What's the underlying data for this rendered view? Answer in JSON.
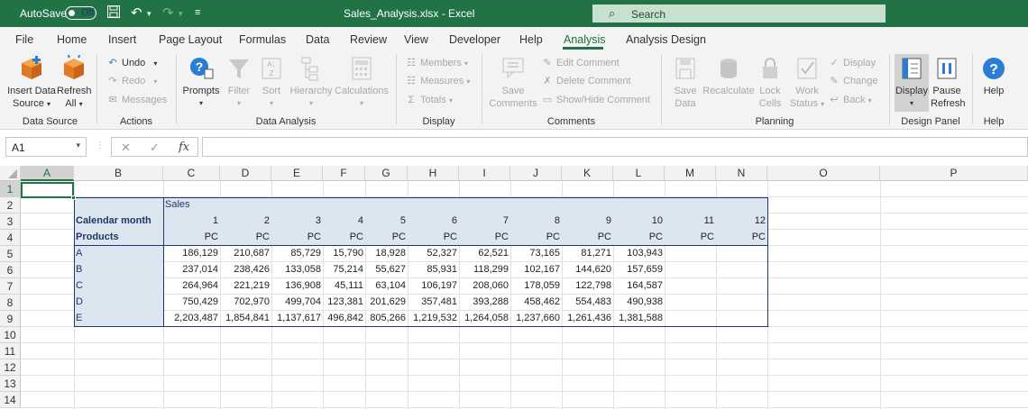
{
  "titlebar": {
    "autosave_label": "AutoSave",
    "autosave_state": "Off",
    "doc_title": "Sales_Analysis.xlsx  -  Excel",
    "search_placeholder": "Search",
    "save_icon": "save-icon",
    "undo_icon": "undo-icon",
    "redo_icon": "redo-icon",
    "customize_icon": "customize-qat-icon"
  },
  "menu": {
    "items": [
      "File",
      "Home",
      "Insert",
      "Page Layout",
      "Formulas",
      "Data",
      "Review",
      "View",
      "Developer",
      "Help",
      "Analysis",
      "Analysis Design"
    ],
    "active": "Analysis"
  },
  "ribbon": {
    "data_source": {
      "insert_line1": "Insert Data",
      "insert_line2": "Source",
      "refresh_line1": "Refresh",
      "refresh_line2": "All",
      "label": "Data Source"
    },
    "actions": {
      "undo": "Undo",
      "redo": "Redo",
      "messages": "Messages",
      "label": "Actions"
    },
    "data_analysis": {
      "prompts": "Prompts",
      "filter": "Filter",
      "sort": "Sort",
      "hierarchy": "Hierarchy",
      "calculations": "Calculations",
      "label": "Data Analysis"
    },
    "display": {
      "members": "Members",
      "measures": "Measures",
      "totals": "Totals",
      "label": "Display"
    },
    "comments": {
      "save_line1": "Save",
      "save_line2": "Comments",
      "edit": "Edit Comment",
      "delete": "Delete Comment",
      "showhide": "Show/Hide Comment",
      "label": "Comments"
    },
    "planning": {
      "save_line1": "Save",
      "save_line2": "Data",
      "recalculate": "Recalculate",
      "lock_line1": "Lock",
      "lock_line2": "Cells",
      "work_line1": "Work",
      "work_line2": "Status",
      "display": "Display",
      "change": "Change",
      "back": "Back",
      "label": "Planning"
    },
    "design_panel": {
      "display": "Display",
      "pause_line1": "Pause",
      "pause_line2": "Refresh",
      "label": "Design Panel"
    },
    "help": {
      "help": "Help",
      "label": "Help"
    }
  },
  "formula_bar": {
    "name_box": "A1",
    "cancel": "✕",
    "enter": "✓",
    "fx": "fx",
    "value": ""
  },
  "sheet": {
    "columns": [
      "A",
      "B",
      "C",
      "D",
      "E",
      "F",
      "G",
      "H",
      "I",
      "J",
      "K",
      "L",
      "M",
      "N",
      "O",
      "P"
    ],
    "rows": [
      "1",
      "2",
      "3",
      "4",
      "5",
      "6",
      "7",
      "8",
      "9",
      "10",
      "11",
      "12",
      "13",
      "14"
    ],
    "sales_label": "Sales",
    "calendar_label": "Calendar month",
    "products_label": "Products",
    "months": [
      "1",
      "2",
      "3",
      "4",
      "5",
      "6",
      "7",
      "8",
      "9",
      "10",
      "11",
      "12"
    ],
    "units": [
      "PC",
      "PC",
      "PC",
      "PC",
      "PC",
      "PC",
      "PC",
      "PC",
      "PC",
      "PC",
      "PC",
      "PC"
    ],
    "data_rows": [
      {
        "product": "A",
        "values": [
          "186,129",
          "210,687",
          "85,729",
          "15,790",
          "18,928",
          "52,327",
          "62,521",
          "73,165",
          "81,271",
          "103,943",
          "",
          ""
        ]
      },
      {
        "product": "B",
        "values": [
          "237,014",
          "238,426",
          "133,058",
          "75,214",
          "55,627",
          "85,931",
          "118,299",
          "102,167",
          "144,620",
          "157,659",
          "",
          ""
        ]
      },
      {
        "product": "C",
        "values": [
          "264,964",
          "221,219",
          "136,908",
          "45,111",
          "63,104",
          "106,197",
          "208,060",
          "178,059",
          "122,798",
          "164,587",
          "",
          ""
        ]
      },
      {
        "product": "D",
        "values": [
          "750,429",
          "702,970",
          "499,704",
          "123,381",
          "201,629",
          "357,481",
          "393,288",
          "458,462",
          "554,483",
          "490,938",
          "",
          ""
        ]
      },
      {
        "product": "E",
        "values": [
          "2,203,487",
          "1,854,841",
          "1,137,617",
          "496,842",
          "805,266",
          "1,219,532",
          "1,264,058",
          "1,237,660",
          "1,261,436",
          "1,381,588",
          "",
          ""
        ]
      }
    ]
  },
  "colors": {
    "accent": "#217346",
    "header_fill": "#dce6f1",
    "header_text": "#1f3864",
    "border": "#1f3864"
  }
}
